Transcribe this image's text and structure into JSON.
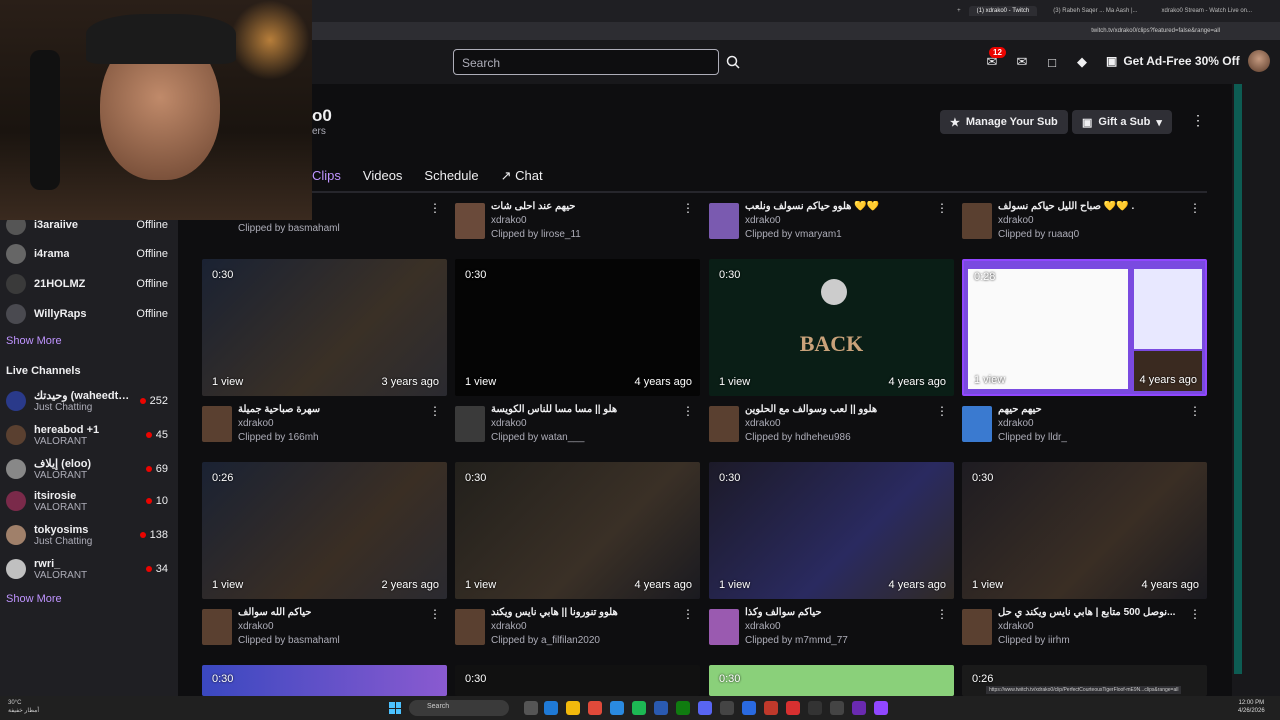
{
  "browser": {
    "tabs": [
      "(1) xdrako0 - Twitch",
      "(3) Rabeh Saqer ... Ma Aash |...",
      "xdrako0 Stream - Watch Live on..."
    ],
    "url": "twitch.tv/xdrako0/clips?featured=false&range=all"
  },
  "topnav": {
    "search_placeholder": "Search",
    "notif_count": "12",
    "adfree_label": "Get Ad-Free 30% Off"
  },
  "channel": {
    "name": "xdrako0",
    "name_visible": "o0",
    "followers_visible": "ers",
    "manage_sub": "Manage Your Sub",
    "gift_sub": "Gift a Sub",
    "tabs": [
      "Clips",
      "Videos",
      "Schedule",
      "Chat"
    ]
  },
  "sidebar": {
    "followed": [
      {
        "name": "i3araiive",
        "status": "Offline"
      },
      {
        "name": "i4rama",
        "status": "Offline"
      },
      {
        "name": "21HOLMZ",
        "status": "Offline"
      },
      {
        "name": "WillyRaps",
        "status": "Offline"
      }
    ],
    "show_more_1": "Show More",
    "live_title": "Live Channels",
    "live": [
      {
        "name": "وحيدتك (waheedte...",
        "game": "Just Chatting",
        "viewers": "252"
      },
      {
        "name": "hereabod +1",
        "game": "VALORANT",
        "viewers": "45"
      },
      {
        "name": "إيلاف (eloo)",
        "game": "VALORANT",
        "viewers": "69"
      },
      {
        "name": "itsirosie",
        "game": "VALORANT",
        "viewers": "10"
      },
      {
        "name": "tokyosims",
        "game": "Just Chatting",
        "viewers": "138"
      },
      {
        "name": "rwri_",
        "game": "VALORANT",
        "viewers": "34"
      }
    ],
    "show_more_2": "Show More"
  },
  "clips_top_row": [
    {
      "title": "",
      "channel": "xdrako0",
      "by": "Clipped by basmahaml"
    },
    {
      "title": "حيهم عند احلى شات",
      "channel": "xdrako0",
      "by": "Clipped by lirose_11"
    },
    {
      "title": "هلوو حياكم نسولف ونلعب 💛💛",
      "channel": "xdrako0",
      "by": "Clipped by vmaryam1"
    },
    {
      "title": "صباح الليل حياكم نسولف 💛💛 .",
      "channel": "xdrako0",
      "by": "Clipped by ruaaq0"
    }
  ],
  "clips_row_2": [
    {
      "duration": "0:30",
      "views": "1 view",
      "ago": "3 years ago",
      "title": "سهرة صباحية جميلة",
      "channel": "xdrako0",
      "by": "Clipped by 166mh"
    },
    {
      "duration": "0:30",
      "views": "1 view",
      "ago": "4 years ago",
      "title": "هلو || مسا مسا للناس الكويسة",
      "channel": "xdrako0",
      "by": "Clipped by watan___"
    },
    {
      "duration": "0:30",
      "views": "1 view",
      "ago": "4 years ago",
      "title": "هلوو || لعب وسوالف مع الحلوين",
      "channel": "xdrako0",
      "by": "Clipped by hdheheu986",
      "thumb_text": "BACK"
    },
    {
      "duration": "0:28",
      "views": "1 view",
      "ago": "4 years ago",
      "title": "حيهم حيهم",
      "channel": "xdrako0",
      "by": "Clipped by lldr_"
    }
  ],
  "clips_row_3": [
    {
      "duration": "0:26",
      "views": "1 view",
      "ago": "2 years ago",
      "title": "حياكم الله سوالف",
      "channel": "xdrako0",
      "by": "Clipped by basmahaml"
    },
    {
      "duration": "0:30",
      "views": "1 view",
      "ago": "4 years ago",
      "title": "هلوو تنورونا || هابي نايس ويكند",
      "channel": "xdrako0",
      "by": "Clipped by a_filfilan2020"
    },
    {
      "duration": "0:30",
      "views": "1 view",
      "ago": "4 years ago",
      "title": "حياكم سوالف وكذا",
      "channel": "xdrako0",
      "by": "Clipped by m7mmd_77"
    },
    {
      "duration": "0:30",
      "views": "1 view",
      "ago": "4 years ago",
      "title": "نوصل 500 متابع | هابي نايس ويكند ي حل...",
      "channel": "xdrako0",
      "by": "Clipped by iirhm"
    }
  ],
  "clips_row_4": [
    {
      "duration": "0:30"
    },
    {
      "duration": "0:30"
    },
    {
      "duration": "0:30"
    },
    {
      "duration": "0:26"
    }
  ],
  "taskbar": {
    "weather_temp": "30°C",
    "weather_desc": "أمطار خفيفة",
    "search": "Search",
    "time": "12:00 PM",
    "date": "4/26/2026"
  },
  "status_url": "https://www.twitch.tv/xdrako0/clip/PerfectCourteousTigerFloof-mE9N...clips&range=all"
}
